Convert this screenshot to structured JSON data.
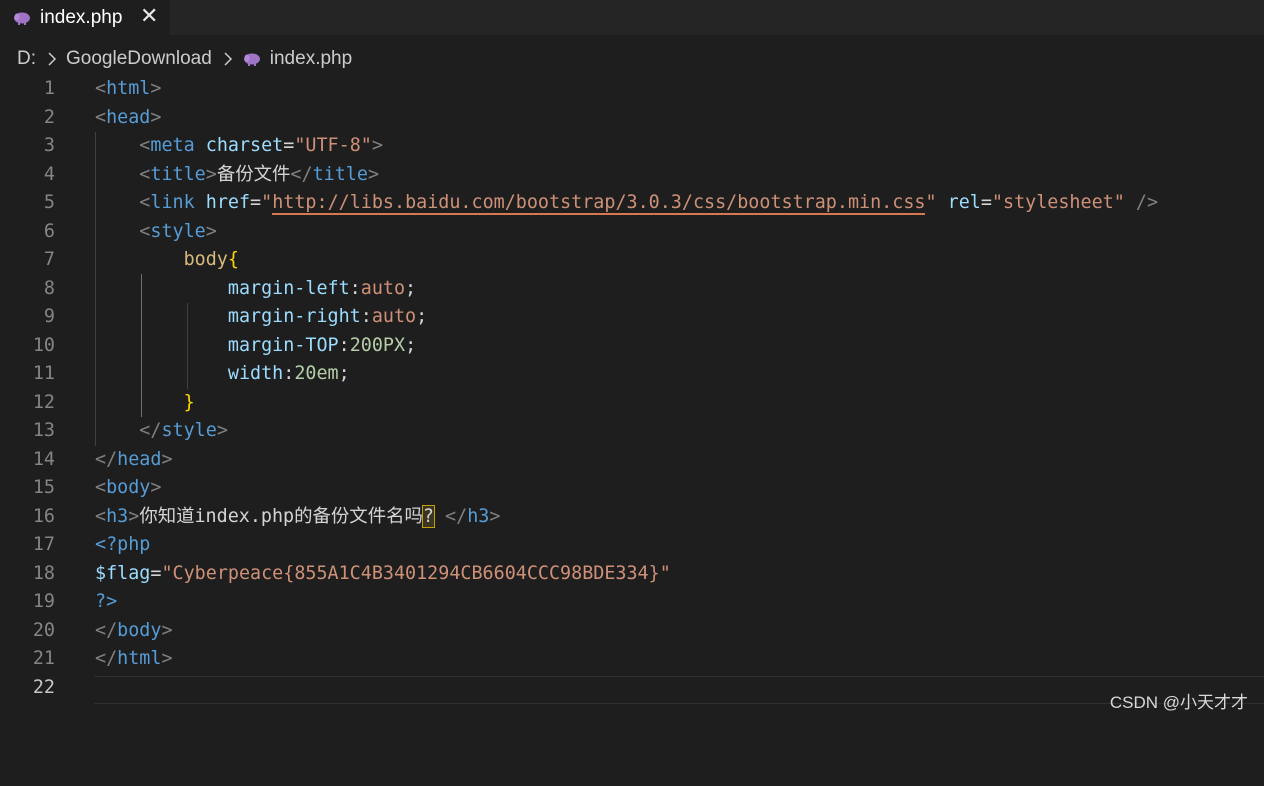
{
  "tab": {
    "filename": "index.php",
    "close_glyph": "✕",
    "icon": "php-elephant-icon"
  },
  "breadcrumb": {
    "drive": "D:",
    "folder": "GoogleDownload",
    "file": "index.php"
  },
  "line_numbers": [
    "1",
    "2",
    "3",
    "4",
    "5",
    "6",
    "7",
    "8",
    "9",
    "10",
    "11",
    "12",
    "13",
    "14",
    "15",
    "16",
    "17",
    "18",
    "19",
    "20",
    "21",
    "22"
  ],
  "current_line": "22",
  "code": {
    "html": "html",
    "head": "head",
    "meta": "meta",
    "charset_attr": "charset",
    "charset_val": "\"UTF-8\"",
    "title_tag": "title",
    "title_text": "备份文件",
    "link": "link",
    "href_attr": "href",
    "href_val": "http://libs.baidu.com/bootstrap/3.0.3/css/bootstrap.min.css",
    "quote": "\"",
    "rel_attr": "rel",
    "rel_val": "\"stylesheet\"",
    "style_tag": "style",
    "body_selector": "body",
    "ml_prop": "margin-left",
    "ml_val": "auto",
    "mr_prop": "margin-right",
    "mr_val": "auto",
    "mt_prop": "margin-TOP",
    "mt_val": "200PX",
    "w_prop": "width",
    "w_val": "20em",
    "body_tag": "body",
    "h3": "h3",
    "h3_text": "你知道index.php的备份文件名吗",
    "question": "?",
    "php_open": "<?php",
    "flag_var": "$flag",
    "flag_val": "\"Cyberpeace{855A1C4B3401294CB6604CCC98BDE334}\"",
    "php_close": "?>"
  },
  "watermark": "CSDN @小天才才",
  "colors": {
    "background": "#1e1e1e",
    "tag": "#569cd6",
    "attribute": "#9cdcfe",
    "string": "#ce9178",
    "selector": "#d7ba7d",
    "number": "#b5cea8",
    "brace": "#ffd700"
  }
}
